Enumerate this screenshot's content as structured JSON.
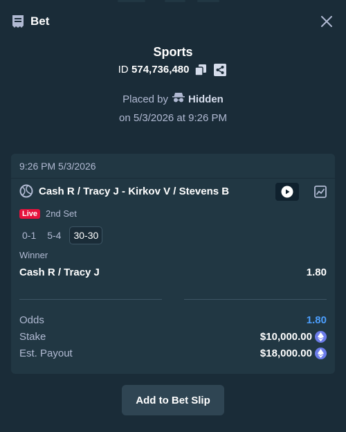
{
  "header": {
    "title": "Bet"
  },
  "bet": {
    "sport": "Sports",
    "id_prefix": "ID",
    "id_number": "574,736,480",
    "placed_by_label": "Placed by",
    "placed_by_user": "Hidden",
    "placed_on": "on 5/3/2026 at 9:26 PM"
  },
  "card": {
    "timestamp": "9:26 PM 5/3/2026",
    "event_name": "Cash R / Tracy J - Kirkov V / Stevens B",
    "live_badge": "Live",
    "period": "2nd Set",
    "scores": [
      "0-1",
      "5-4",
      "30-30"
    ],
    "market": "Winner",
    "selection": "Cash R / Tracy J",
    "selection_odds": "1.80",
    "summary": {
      "odds_label": "Odds",
      "odds_value": "1.80",
      "stake_label": "Stake",
      "stake_value": "$10,000.00",
      "payout_label": "Est. Payout",
      "payout_value": "$18,000.00"
    }
  },
  "actions": {
    "add_to_slip": "Add to Bet Slip"
  },
  "colors": {
    "background": "#1a2c38",
    "card": "#213743",
    "live": "#e6123d",
    "odds": "#4c9ffe",
    "button": "#2f4553"
  },
  "icons": [
    "ticket-icon",
    "close-icon",
    "copy-icon",
    "share-icon",
    "incognito-icon",
    "tennis-ball-icon",
    "play-icon",
    "stats-icon",
    "eth-icon"
  ]
}
